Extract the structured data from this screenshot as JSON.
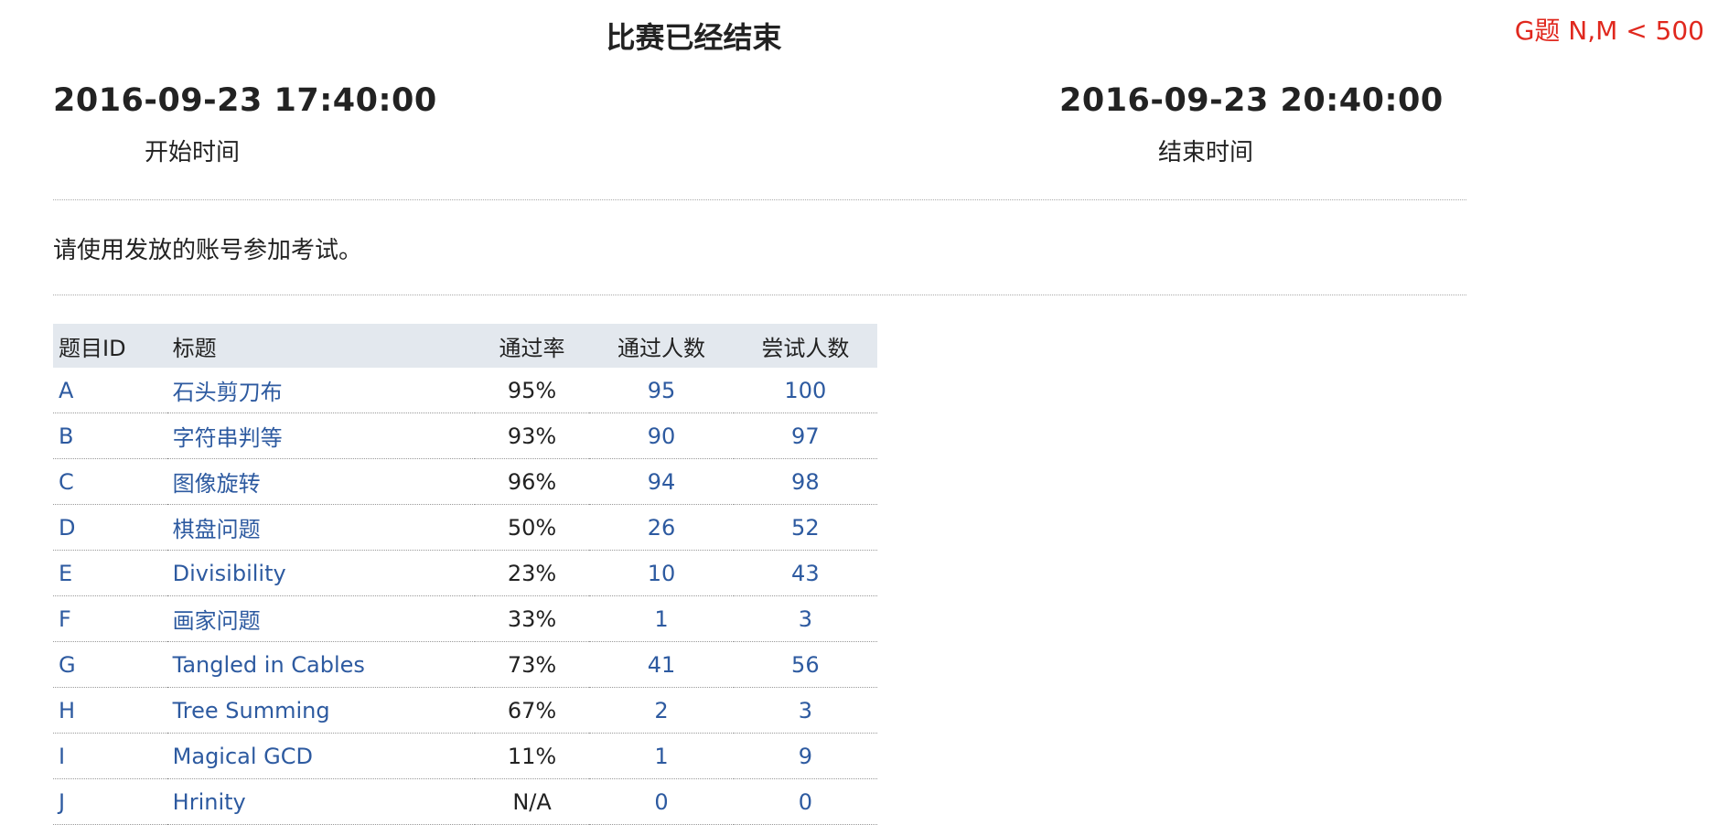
{
  "contest": {
    "status_title": "比赛已经结束",
    "notice": "G题 N,M < 500",
    "start_time": "2016-09-23 17:40:00",
    "start_label": "开始时间",
    "end_time": "2016-09-23 20:40:00",
    "end_label": "结束时间",
    "instruction": "请使用发放的账号参加考试。"
  },
  "table": {
    "headers": {
      "id": "题目ID",
      "title": "标题",
      "rate": "通过率",
      "accepted": "通过人数",
      "attempted": "尝试人数"
    },
    "rows": [
      {
        "id": "A",
        "title": "石头剪刀布",
        "rate": "95%",
        "accepted": "95",
        "attempted": "100"
      },
      {
        "id": "B",
        "title": "字符串判等",
        "rate": "93%",
        "accepted": "90",
        "attempted": "97"
      },
      {
        "id": "C",
        "title": "图像旋转",
        "rate": "96%",
        "accepted": "94",
        "attempted": "98"
      },
      {
        "id": "D",
        "title": "棋盘问题",
        "rate": "50%",
        "accepted": "26",
        "attempted": "52"
      },
      {
        "id": "E",
        "title": "Divisibility",
        "rate": "23%",
        "accepted": "10",
        "attempted": "43"
      },
      {
        "id": "F",
        "title": "画家问题",
        "rate": "33%",
        "accepted": "1",
        "attempted": "3"
      },
      {
        "id": "G",
        "title": "Tangled in Cables",
        "rate": "73%",
        "accepted": "41",
        "attempted": "56"
      },
      {
        "id": "H",
        "title": "Tree Summing",
        "rate": "67%",
        "accepted": "2",
        "attempted": "3"
      },
      {
        "id": "I",
        "title": "Magical GCD",
        "rate": "11%",
        "accepted": "1",
        "attempted": "9"
      },
      {
        "id": "J",
        "title": "Hrinity",
        "rate": "N/A",
        "accepted": "0",
        "attempted": "0"
      }
    ]
  },
  "colors": {
    "link": "#2d5aa0",
    "notice": "#e0281e",
    "header_bg": "#e3e8ee"
  }
}
